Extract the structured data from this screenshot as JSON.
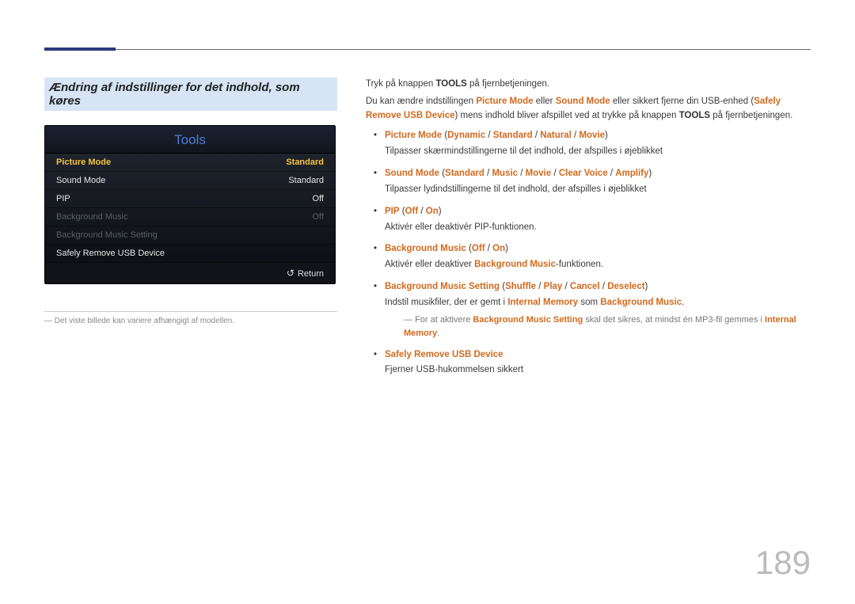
{
  "section_title": "Ændring af indstillinger for det indhold, som køres",
  "tools": {
    "header": "Tools",
    "rows": [
      {
        "label": "Picture Mode",
        "value": "Standard",
        "state": "selected"
      },
      {
        "label": "Sound Mode",
        "value": "Standard",
        "state": "normal"
      },
      {
        "label": "PIP",
        "value": "Off",
        "state": "normal"
      },
      {
        "label": "Background Music",
        "value": "Off",
        "state": "disabled"
      },
      {
        "label": "Background Music Setting",
        "value": "",
        "state": "disabled"
      },
      {
        "label": "Safely Remove USB Device",
        "value": "",
        "state": "normal"
      }
    ],
    "return_label": "Return"
  },
  "caption": "Det viste billede kan variere afhængigt af modellen.",
  "intro": {
    "line1_pre": "Tryk på knappen ",
    "line1_bold": "TOOLS",
    "line1_post": " på fjernbetjeningen.",
    "line2_pre": "Du kan ændre indstillingen ",
    "pm": "Picture Mode",
    "line2_mid1": " eller ",
    "sm": "Sound Mode",
    "line2_mid2": " eller sikkert fjerne din USB-enhed (",
    "sr": "Safely Remove USB Device",
    "line2_post": ") mens indhold bliver afspillet ved at trykke på knappen ",
    "tools2": "TOOLS",
    "line2_end": " på fjernbetjeningen."
  },
  "options": {
    "picture": {
      "name": "Picture Mode",
      "vals": [
        "Dynamic",
        "Standard",
        "Natural",
        "Movie"
      ],
      "desc": "Tilpasser skærmindstillingerne til det indhold, der afspilles i øjeblikket"
    },
    "sound": {
      "name": "Sound Mode",
      "vals": [
        "Standard",
        "Music",
        "Movie",
        "Clear Voice",
        "Amplify"
      ],
      "desc": "Tilpasser lydindstillingerne til det indhold, der afspilles i øjeblikket"
    },
    "pip": {
      "name": "PIP",
      "vals": [
        "Off",
        "On"
      ],
      "desc": "Aktivér eller deaktivér PIP-funktionen."
    },
    "bgm": {
      "name": "Background Music",
      "vals": [
        "Off",
        "On"
      ],
      "desc_pre": "Aktivér eller deaktiver ",
      "desc_hi": "Background Music",
      "desc_post": "-funktionen."
    },
    "bgms": {
      "name": "Background Music Setting",
      "vals": [
        "Shuffle",
        "Play",
        "Cancel",
        "Deselect"
      ],
      "desc_pre": "Indstil musikfiler, der er gemt i ",
      "desc_hi1": "Internal Memory",
      "desc_mid": " som ",
      "desc_hi2": "Background Music",
      "desc_post": ".",
      "note_pre": "For at aktivere ",
      "note_hi1": "Background Music Setting",
      "note_mid": " skal det sikres, at mindst én MP3-fil gemmes i ",
      "note_hi2": "Internal Memory",
      "note_post": "."
    },
    "safe": {
      "name": "Safely Remove USB Device",
      "desc": "Fjerner USB-hukommelsen sikkert"
    }
  },
  "page_number": "189",
  "sep": " / "
}
